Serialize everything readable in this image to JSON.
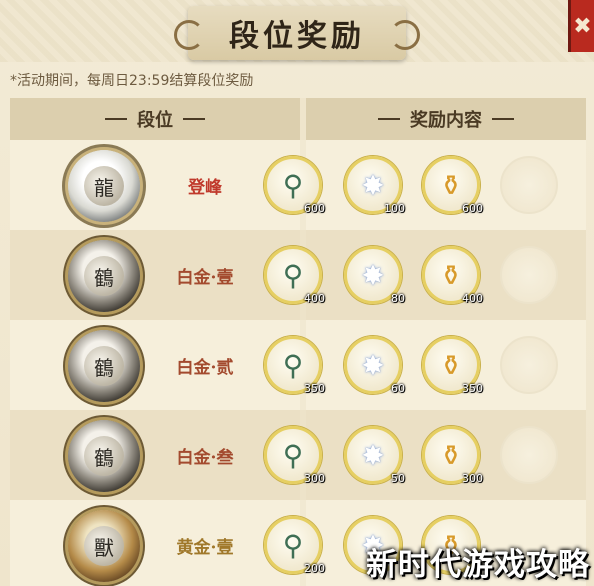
{
  "title": "段位奖励",
  "close_icon": "✖",
  "notice": "*活动期间，每周日23:59结算段位奖励",
  "header": {
    "rank": "段位",
    "rewards": "奖励内容"
  },
  "reward_icons": [
    "jade-tassel-icon",
    "star-crystal-icon",
    "golden-bottle-icon",
    "empty-slot-icon"
  ],
  "rows": [
    {
      "rank": "登峰",
      "rank_color": "#c0392b",
      "emblem": "dragon-emblem-icon",
      "rewards": [
        "600",
        "100",
        "600"
      ]
    },
    {
      "rank": "白金·壹",
      "rank_color": "#a34a2e",
      "emblem": "crane-emblem-icon",
      "rewards": [
        "400",
        "80",
        "400"
      ]
    },
    {
      "rank": "白金·贰",
      "rank_color": "#a34a2e",
      "emblem": "crane-emblem-icon",
      "rewards": [
        "350",
        "60",
        "350"
      ]
    },
    {
      "rank": "白金·叁",
      "rank_color": "#a34a2e",
      "emblem": "crane-emblem-icon",
      "rewards": [
        "300",
        "50",
        "300"
      ]
    },
    {
      "rank": "黄金·壹",
      "rank_color": "#a0782a",
      "emblem": "beast-emblem-icon",
      "rewards": [
        "200",
        "",
        ""
      ]
    }
  ],
  "watermark": "新时代游戏攻略"
}
